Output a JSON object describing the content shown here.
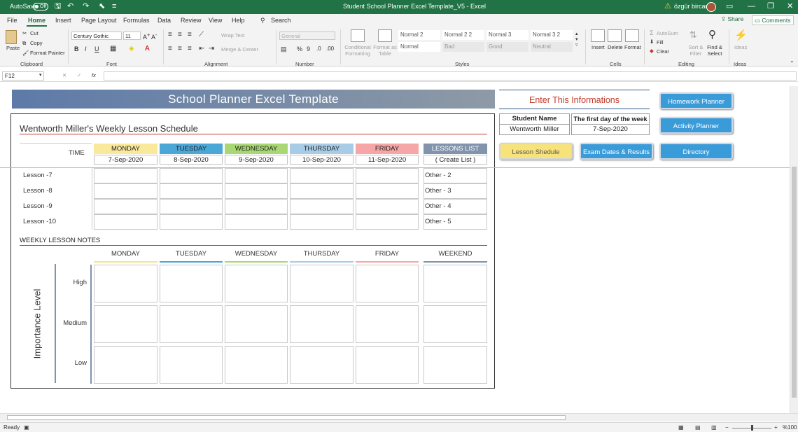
{
  "window": {
    "autosave": "AutoSave",
    "autosave_state": "Off",
    "title": "Student School Planner Excel Template_V5  -  Excel",
    "user": "özgür bircan",
    "accent": "#217346"
  },
  "tabs": [
    "File",
    "Home",
    "Insert",
    "Page Layout",
    "Formulas",
    "Data",
    "Review",
    "View",
    "Help"
  ],
  "tab_search": "Search",
  "share": "Share",
  "comments": "Comments",
  "ribbon": {
    "clipboard": {
      "paste": "Paste",
      "cut": "Cut",
      "copy": "Copy",
      "format_painter": "Format Painter",
      "label": "Clipboard"
    },
    "font": {
      "name": "Century Gothic",
      "size": "11",
      "bold": "B",
      "italic": "I",
      "underline": "U",
      "label": "Font"
    },
    "alignment": {
      "wrap": "Wrap Text",
      "merge": "Merge & Center",
      "label": "Alignment"
    },
    "number": {
      "format": "General",
      "label": "Number"
    },
    "styles": {
      "conditional": "Conditional Formatting",
      "format_as": "Format as Table",
      "cells": [
        "Normal 2",
        "Normal 2 2",
        "Normal 3",
        "Normal 3 2",
        "Normal",
        "Bad",
        "Good",
        "Neutral"
      ],
      "label": "Styles"
    },
    "cells": {
      "insert": "Insert",
      "delete": "Delete",
      "format": "Format",
      "label": "Cells"
    },
    "editing": {
      "autosum": "AutoSum",
      "fill": "Fill",
      "clear": "Clear",
      "sort": "Sort & Filter",
      "find": "Find & Select",
      "label": "Editing"
    },
    "ideas": {
      "ideas": "Ideas",
      "label": "Ideas"
    }
  },
  "formula_bar": {
    "name_box": "F12",
    "fx": "fx",
    "cancel": "✕",
    "enter": "✓"
  },
  "sheet": {
    "banner": "School Planner Excel Template",
    "schedule_title": "Wentworth Miller's Weekly Lesson Schedule",
    "time_label": "TIME",
    "days": [
      {
        "name": "MONDAY",
        "date": "7-Sep-2020",
        "color": "#fbe99b"
      },
      {
        "name": "TUESDAY",
        "date": "8-Sep-2020",
        "color": "#4aa7d8"
      },
      {
        "name": "WEDNESDAY",
        "date": "9-Sep-2020",
        "color": "#a9d774"
      },
      {
        "name": "THURSDAY",
        "date": "10-Sep-2020",
        "color": "#a8cce6"
      },
      {
        "name": "FRIDAY",
        "date": "11-Sep-2020",
        "color": "#f6a6a6"
      }
    ],
    "lessons_list": {
      "header": "LESSONS LIST",
      "sub": "( Create List )",
      "color": "#8193ad"
    },
    "lessons": [
      "Lesson -7",
      "Lesson -8",
      "Lesson -9",
      "Lesson -10"
    ],
    "others": [
      "Other - 2",
      "Other - 3",
      "Other - 4",
      "Other - 5"
    ],
    "notes_title": "WEEKLY LESSON NOTES",
    "notes_days": [
      "MONDAY",
      "TUESDAY",
      "WEDNESDAY",
      "THURSDAY",
      "FRIDAY",
      "WEEKEND"
    ],
    "notes_colors": [
      "#f7e58a",
      "#4aa7d8",
      "#a9d774",
      "#a8cce6",
      "#f6a6a6",
      "#8193ad"
    ],
    "importance": "Importance Level",
    "levels": [
      "High",
      "Medium",
      "Low"
    ],
    "enter_info": "Enter This Informations",
    "student_name_label": "Student Name",
    "student_name": "Wentworth Miller",
    "first_day_label": "The first day of the week",
    "first_day": "7-Sep-2020",
    "buttons": [
      "Homework Planner",
      "Activity Planner",
      "Lesson Shedule",
      "Exam Dates & Results",
      "Directory"
    ]
  },
  "status": {
    "ready": "Ready",
    "zoom": "%100"
  }
}
